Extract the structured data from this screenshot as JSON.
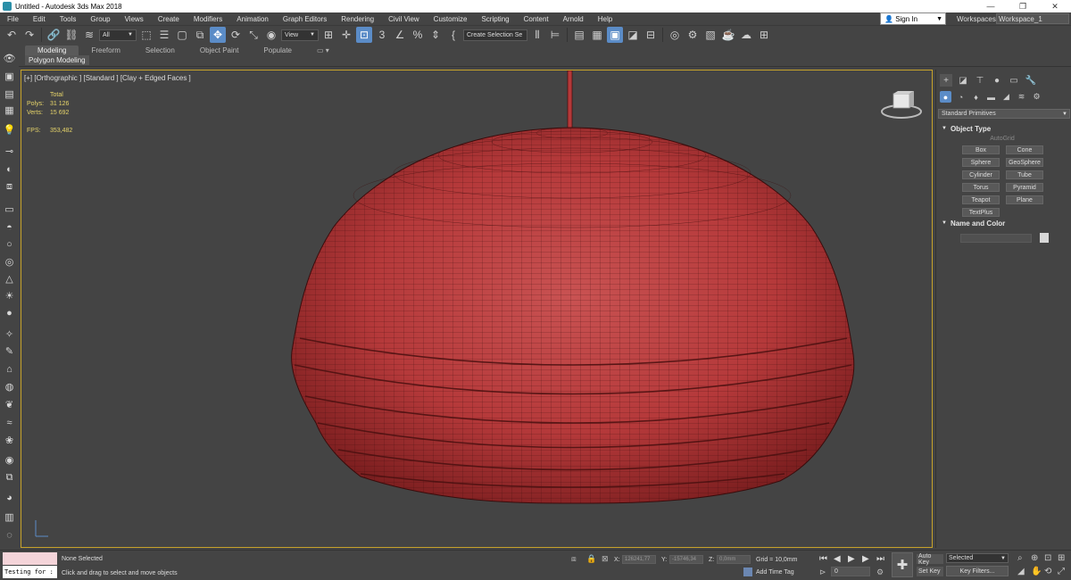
{
  "window": {
    "title": "Untitled - Autodesk 3ds Max 2018",
    "minimize": "—",
    "restore": "❐",
    "close": "✕"
  },
  "menubar": {
    "items": [
      "File",
      "Edit",
      "Tools",
      "Group",
      "Views",
      "Create",
      "Modifiers",
      "Animation",
      "Graph Editors",
      "Rendering",
      "Civil View",
      "Customize",
      "Scripting",
      "Content",
      "Arnold",
      "Help"
    ],
    "signin": "Sign In",
    "workspaces_label": "Workspaces:",
    "workspace_value": "Workspace_1"
  },
  "toolbar": {
    "filter_value": "All",
    "refcoord_value": "View",
    "selection_set_placeholder": "Create Selection Se"
  },
  "ribbon": {
    "tabs": [
      "Modeling",
      "Freeform",
      "Selection",
      "Object Paint",
      "Populate"
    ],
    "selected_tab": "Modeling",
    "subtitle": "Polygon Modeling"
  },
  "viewport": {
    "label": "[+] [Orthographic ] [Standard ] [Clay + Edged Faces ]",
    "stats": {
      "total_label": "Total",
      "polys_label": "Polys:",
      "polys_value": "31 126",
      "verts_label": "Verts:",
      "verts_value": "15 692",
      "fps_label": "FPS:",
      "fps_value": "353,482"
    },
    "model_color": "#b5393a",
    "border_color": "#c7a32a"
  },
  "command_panel": {
    "primitive_type": "Standard Primitives",
    "object_type_title": "Object Type",
    "autogrid": "AutoGrid",
    "object_buttons": [
      "Box",
      "Cone",
      "Sphere",
      "GeoSphere",
      "Cylinder",
      "Tube",
      "Torus",
      "Pyramid",
      "Teapot",
      "Plane",
      "TextPlus"
    ],
    "name_color_title": "Name and Color"
  },
  "statusbar": {
    "maxscript_text": "Testing for :",
    "selection_status": "None Selected",
    "hint": "Click and drag to select and move objects",
    "x_label": "X:",
    "x_value": "126241,77",
    "y_label": "Y:",
    "y_value": "-15746,34",
    "z_label": "Z:",
    "z_value": "0,0mm",
    "grid": "Grid = 10,0mm",
    "add_time_tag": "Add Time Tag",
    "frame_value": "0",
    "auto_key": "Auto Key",
    "set_key": "Set Key",
    "selected_value": "Selected",
    "key_filters": "Key Filters..."
  }
}
